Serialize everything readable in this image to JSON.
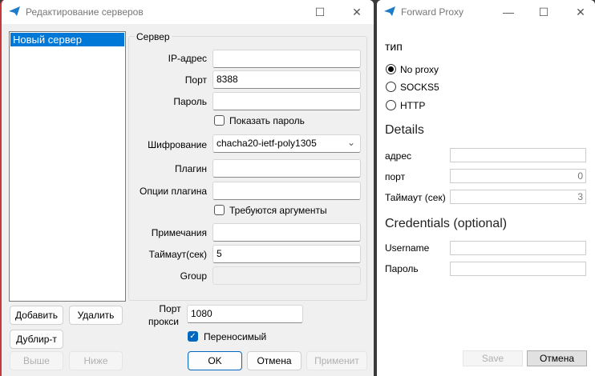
{
  "left_window": {
    "title": "Редактирование серверов",
    "server_list": [
      "Новый сервер"
    ],
    "group_title": "Сервер",
    "fields": {
      "ip_label": "IP-адрес",
      "ip_value": "",
      "port_label": "Порт",
      "port_value": "8388",
      "password_label": "Пароль",
      "password_value": "",
      "show_password": "Показать пароль",
      "cipher_label": "Шифрование",
      "cipher_value": "chacha20-ietf-poly1305",
      "plugin_label": "Плагин",
      "plugin_value": "",
      "plugin_opts_label": "Опции плагина",
      "plugin_opts_value": "",
      "requires_args": "Требуются аргументы",
      "notes_label": "Примечания",
      "notes_value": "",
      "timeout_label": "Таймаут(сек)",
      "timeout_value": "5",
      "group_label": "Group",
      "group_value": ""
    },
    "buttons": {
      "add": "Добавить",
      "delete": "Удалить",
      "duplicate": "Дублир-т",
      "up": "Выше",
      "down": "Ниже",
      "ok": "OK",
      "cancel": "Отмена",
      "apply": "Применит"
    },
    "proxy_port_label_1": "Порт",
    "proxy_port_label_2": "прокси",
    "proxy_port_value": "1080",
    "portable_label": "Переносимый",
    "portable_checked": true
  },
  "right_window": {
    "title": "Forward Proxy",
    "type_heading": "тип",
    "options": [
      "No proxy",
      "SOCKS5",
      "HTTP"
    ],
    "selected": "No proxy",
    "details_heading": "Details",
    "address_label": "адрес",
    "address_value": "",
    "port_label": "порт",
    "port_value": "0",
    "timeout_label": "Таймаут (сек)",
    "timeout_value": "3",
    "credentials_heading": "Credentials (optional)",
    "username_label": "Username",
    "username_value": "",
    "password_label": "Пароль",
    "password_value": "",
    "save": "Save",
    "cancel": "Отмена"
  },
  "colors": {
    "accent": "#0078d7",
    "selection": "#0078d7"
  }
}
